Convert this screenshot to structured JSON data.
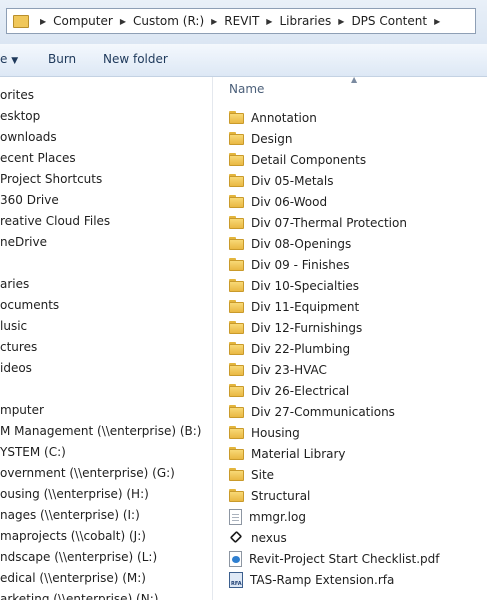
{
  "address_bar": {
    "crumbs": [
      "Computer",
      "Custom (R:)",
      "REVIT",
      "Libraries",
      "DPS Content"
    ]
  },
  "toolbar": {
    "organize_label": "e",
    "burn_label": "Burn",
    "new_folder_label": "New folder"
  },
  "nav": {
    "items": [
      "orites",
      "esktop",
      "ownloads",
      "ecent Places",
      "Project Shortcuts",
      "360 Drive",
      "reative Cloud Files",
      "neDrive",
      "",
      "aries",
      "ocuments",
      "lusic",
      "ctures",
      "ideos",
      "",
      "mputer",
      "M Management (\\\\enterprise) (B:)",
      "YSTEM (C:)",
      "overnment (\\\\enterprise) (G:)",
      "ousing (\\\\enterprise) (H:)",
      "nages (\\\\enterprise) (I:)",
      "maprojects (\\\\cobalt) (J:)",
      "ndscape (\\\\enterprise) (L:)",
      "edical (\\\\enterprise) (M:)",
      "arketing (\\\\enterprise) (N:)"
    ]
  },
  "content": {
    "column_name": "Name",
    "rows": [
      {
        "label": "Annotation",
        "icon": "folder-icon"
      },
      {
        "label": "Design",
        "icon": "folder-icon"
      },
      {
        "label": "Detail Components",
        "icon": "folder-icon"
      },
      {
        "label": "Div 05-Metals",
        "icon": "folder-icon"
      },
      {
        "label": "Div 06-Wood",
        "icon": "folder-icon"
      },
      {
        "label": "Div 07-Thermal Protection",
        "icon": "folder-icon"
      },
      {
        "label": "Div 08-Openings",
        "icon": "folder-icon"
      },
      {
        "label": "Div 09 - Finishes",
        "icon": "folder-icon"
      },
      {
        "label": "Div 10-Specialties",
        "icon": "folder-icon"
      },
      {
        "label": "Div 11-Equipment",
        "icon": "folder-icon"
      },
      {
        "label": "Div 12-Furnishings",
        "icon": "folder-icon"
      },
      {
        "label": "Div 22-Plumbing",
        "icon": "folder-icon"
      },
      {
        "label": "Div 23-HVAC",
        "icon": "folder-icon"
      },
      {
        "label": "Div 26-Electrical",
        "icon": "folder-icon"
      },
      {
        "label": "Div 27-Communications",
        "icon": "folder-icon"
      },
      {
        "label": "Housing",
        "icon": "folder-icon"
      },
      {
        "label": "Material Library",
        "icon": "folder-icon"
      },
      {
        "label": "Site",
        "icon": "folder-icon"
      },
      {
        "label": "Structural",
        "icon": "folder-icon"
      },
      {
        "label": "mmgr.log",
        "icon": "text-file-icon"
      },
      {
        "label": "nexus",
        "icon": "nexus-icon"
      },
      {
        "label": "Revit-Project Start Checklist.pdf",
        "icon": "pdf-file-icon"
      },
      {
        "label": "TAS-Ramp Extension.rfa",
        "icon": "rfa-file-icon"
      }
    ]
  }
}
